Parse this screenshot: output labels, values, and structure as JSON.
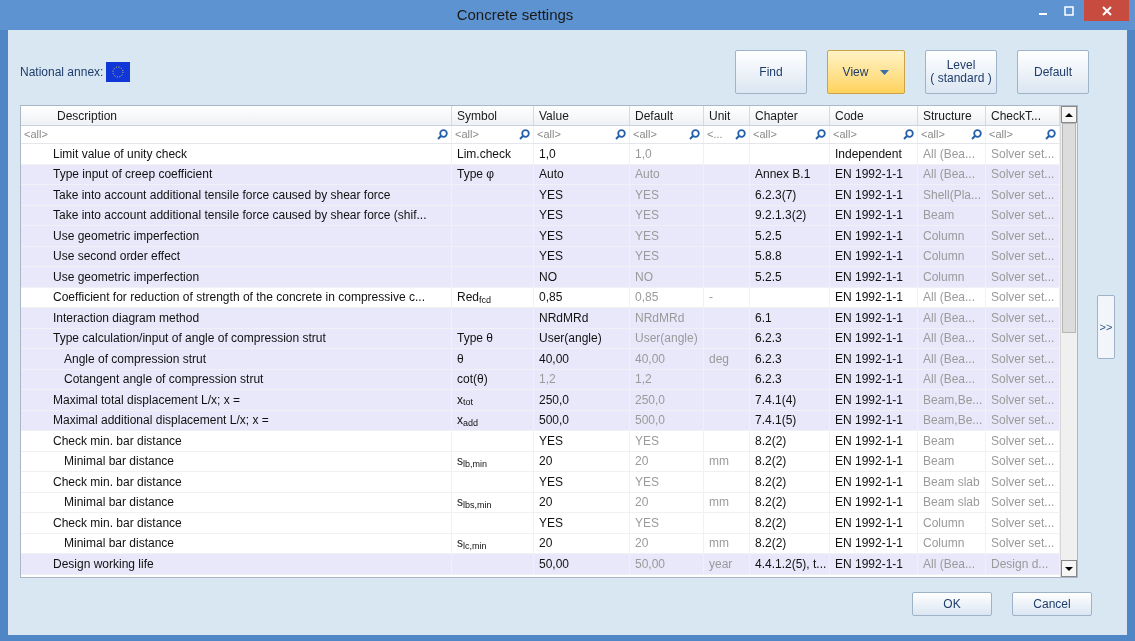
{
  "window": {
    "title": "Concrete settings"
  },
  "national_annex": {
    "label": "National annex:"
  },
  "toolbar": [
    {
      "label": "Find",
      "kind": "plain"
    },
    {
      "label": "View",
      "kind": "dropdown"
    },
    {
      "label": "Level\n( standard )",
      "kind": "plain"
    },
    {
      "label": "Default",
      "kind": "plain"
    }
  ],
  "table": {
    "columns": [
      {
        "label": "Description",
        "filter": "<all>"
      },
      {
        "label": "Symbol",
        "filter": "<all>"
      },
      {
        "label": "Value",
        "filter": "<all>"
      },
      {
        "label": "Default",
        "filter": "<all>"
      },
      {
        "label": "Unit",
        "filter": "<..."
      },
      {
        "label": "Chapter",
        "filter": "<all>"
      },
      {
        "label": "Code",
        "filter": "<all>"
      },
      {
        "label": "Structure",
        "filter": "<all>"
      },
      {
        "label": "CheckT...",
        "filter": "<all>"
      }
    ],
    "rows": [
      {
        "shaded": false,
        "description": "Limit value of unity check",
        "symbol": "Lim.check",
        "value": "1,0",
        "default": "1,0",
        "code": "Independent",
        "structure": "All (Bea...",
        "check_type": "Solver set..."
      },
      {
        "shaded": true,
        "description": "Type input of creep coefficient",
        "symbol": "Type φ",
        "value": "Auto",
        "default": "Auto",
        "chapter": "Annex B.1",
        "code": "EN 1992-1-1",
        "structure": "All (Bea...",
        "check_type": "Solver set..."
      },
      {
        "shaded": true,
        "description": "Take into account additional tensile force caused by shear force",
        "value": "YES",
        "default": "YES",
        "chapter": "6.2.3(7)",
        "code": "EN 1992-1-1",
        "structure": "Shell(Pla...",
        "check_type": "Solver set..."
      },
      {
        "shaded": true,
        "description": "Take into account additional tensile force caused by shear force (shif...",
        "value": "YES",
        "default": "YES",
        "chapter": "9.2.1.3(2)",
        "code": "EN 1992-1-1",
        "structure": "Beam",
        "check_type": "Solver set..."
      },
      {
        "shaded": true,
        "description": "Use geometric imperfection",
        "value": "YES",
        "default": "YES",
        "chapter": "5.2.5",
        "code": "EN 1992-1-1",
        "structure": "Column",
        "check_type": "Solver set..."
      },
      {
        "shaded": true,
        "description": "Use second order effect",
        "value": "YES",
        "default": "YES",
        "chapter": "5.8.8",
        "code": "EN 1992-1-1",
        "structure": "Column",
        "check_type": "Solver set..."
      },
      {
        "shaded": true,
        "description": "Use geometric imperfection",
        "value": "NO",
        "default": "NO",
        "chapter": "5.2.5",
        "code": "EN 1992-1-1",
        "structure": "Column",
        "check_type": "Solver set..."
      },
      {
        "shaded": false,
        "description": "Coefficient for reduction of strength of the concrete in compressive c...",
        "symbol": "Red$_{fcd}$",
        "value": "0,85",
        "default": "0,85",
        "unit": "-",
        "code": "EN 1992-1-1",
        "structure": "All (Bea...",
        "check_type": "Solver set..."
      },
      {
        "shaded": true,
        "description": "Interaction diagram method",
        "value": "NRdMRd",
        "default": "NRdMRd",
        "chapter": "6.1",
        "code": "EN 1992-1-1",
        "structure": "All (Bea...",
        "check_type": "Solver set..."
      },
      {
        "shaded": true,
        "description": "Type calculation/input of angle of compression strut",
        "symbol": "Type θ",
        "value": "User(angle)",
        "default": "User(angle)",
        "chapter": "6.2.3",
        "code": "EN 1992-1-1",
        "structure": "All (Bea...",
        "check_type": "Solver set...",
        "children": [
          {
            "shaded": true,
            "description": "Angle of compression strut",
            "symbol": "θ",
            "value": "40,00",
            "default": "40,00",
            "unit": "deg",
            "chapter": "6.2.3",
            "code": "EN 1992-1-1",
            "structure": "All (Bea...",
            "check_type": "Solver set..."
          },
          {
            "shaded": true,
            "disabled": true,
            "description": "Cotangent angle of compression strut",
            "symbol": "cot(θ)",
            "value": "1,2",
            "default": "1,2",
            "chapter": "6.2.3",
            "code": "EN 1992-1-1",
            "structure": "All (Bea...",
            "check_type": "Solver set..."
          }
        ]
      },
      {
        "shaded": true,
        "description": "Maximal total displacement L/x; x =",
        "symbol": "x$_{tot}$",
        "value": "250,0",
        "default": "250,0",
        "chapter": "7.4.1(4)",
        "code": "EN 1992-1-1",
        "structure": "Beam,Be...",
        "check_type": "Solver set..."
      },
      {
        "shaded": true,
        "description": "Maximal additional displacement L/x; x =",
        "symbol": "x$_{add}$",
        "value": "500,0",
        "default": "500,0",
        "chapter": "7.4.1(5)",
        "code": "EN 1992-1-1",
        "structure": "Beam,Be...",
        "check_type": "Solver set..."
      },
      {
        "shaded": false,
        "description": "Check min. bar distance",
        "value": "YES",
        "default": "YES",
        "chapter": "8.2(2)",
        "code": "EN 1992-1-1",
        "structure": "Beam",
        "check_type": "Solver set...",
        "children": [
          {
            "shaded": false,
            "description": "Minimal bar distance",
            "symbol": "s$_{lb,min}$",
            "value": "20",
            "default": "20",
            "unit": "mm",
            "chapter": "8.2(2)",
            "code": "EN 1992-1-1",
            "structure": "Beam",
            "check_type": "Solver set..."
          }
        ]
      },
      {
        "shaded": false,
        "description": "Check min. bar distance",
        "value": "YES",
        "default": "YES",
        "chapter": "8.2(2)",
        "code": "EN 1992-1-1",
        "structure": "Beam slab",
        "check_type": "Solver set...",
        "children": [
          {
            "shaded": false,
            "description": "Minimal bar distance",
            "symbol": "s$_{lbs,min}$",
            "value": "20",
            "default": "20",
            "unit": "mm",
            "chapter": "8.2(2)",
            "code": "EN 1992-1-1",
            "structure": "Beam slab",
            "check_type": "Solver set..."
          }
        ]
      },
      {
        "shaded": false,
        "description": "Check min. bar distance",
        "value": "YES",
        "default": "YES",
        "chapter": "8.2(2)",
        "code": "EN 1992-1-1",
        "structure": "Column",
        "check_type": "Solver set...",
        "children": [
          {
            "shaded": false,
            "description": "Minimal bar distance",
            "symbol": "s$_{lc,min}$",
            "value": "20",
            "default": "20",
            "unit": "mm",
            "chapter": "8.2(2)",
            "code": "EN 1992-1-1",
            "structure": "Column",
            "check_type": "Solver set..."
          }
        ]
      },
      {
        "shaded": true,
        "description": "Design working life",
        "value": "50,00",
        "default": "50,00",
        "unit": "year",
        "chapter": "4.4.1.2(5), t...",
        "code": "EN 1992-1-1",
        "structure": "All (Bea...",
        "check_type": "Design d..."
      }
    ]
  },
  "side_button": {
    "label": ">>"
  },
  "buttons": [
    {
      "label": "OK"
    },
    {
      "label": "Cancel"
    }
  ]
}
